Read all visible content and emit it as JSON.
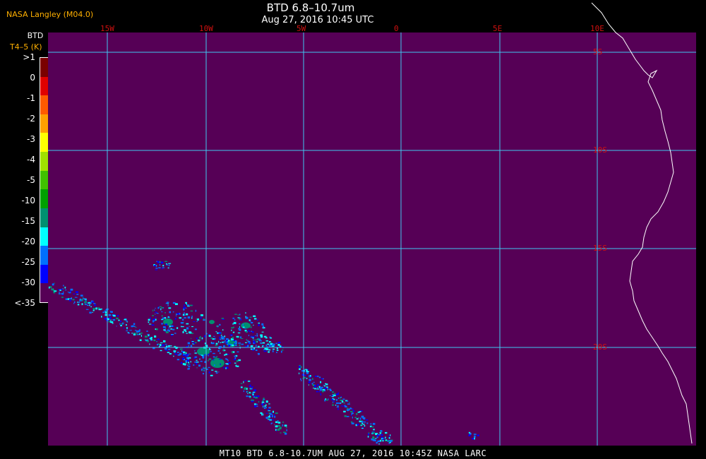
{
  "header": {
    "credit": "NASA Langley (M04.0)",
    "title": "BTD 6.8–10.7um",
    "subtitle": "Aug 27, 2016 10:45 UTC"
  },
  "legend": {
    "title": "BTD",
    "unit": "T4–5 (K)",
    "entries": [
      {
        "label": ">1",
        "color": "#7a0000"
      },
      {
        "label": "0",
        "color": "#e00000"
      },
      {
        "label": "-1",
        "color": "#ff5a00"
      },
      {
        "label": "-2",
        "color": "#ffa000"
      },
      {
        "label": "-3",
        "color": "#ffff00"
      },
      {
        "label": "-4",
        "color": "#a0e000"
      },
      {
        "label": "-5",
        "color": "#40c000"
      },
      {
        "label": "-10",
        "color": "#00a000"
      },
      {
        "label": "-15",
        "color": "#009070"
      },
      {
        "label": "-20",
        "color": "#00ffff"
      },
      {
        "label": "-25",
        "color": "#0070ff"
      },
      {
        "label": "-30",
        "color": "#0000ff"
      },
      {
        "label": "<-35",
        "color": "#560056"
      }
    ]
  },
  "map": {
    "background_color": "#560056",
    "grid_color": "#40c8f0",
    "coast_color": "#ffffff",
    "lon_labels": [
      "15W",
      "10W",
      "5W",
      "0",
      "5E",
      "10E"
    ],
    "lat_labels": [
      "5S",
      "10S",
      "15S",
      "20S"
    ]
  },
  "footer": {
    "text": "MT10  BTD 6.8-10.7UM   AUG 27, 2016 10:45Z   NASA LARC"
  }
}
